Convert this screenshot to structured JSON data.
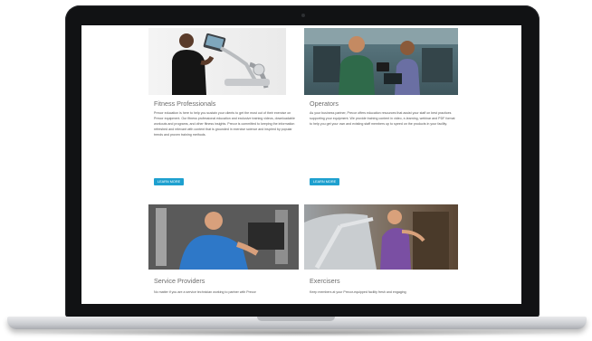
{
  "page": {
    "cards": [
      {
        "title": "Fitness Professionals",
        "body": "Precor education is here to help you sustain your clients to get the most out of their exercise on Precor equipment. Our fitness professional education and exclusive training videos, downloadable workouts and programs, and other fitness insights. Precor is committed to keeping the information refreshed and relevant with content that is grounded in exercise science and inspired by popular trends and proven training methods.",
        "button": "LEARN MORE"
      },
      {
        "title": "Operators",
        "body": "As your business partner, Precor offers education resources that assist your staff on best practices supporting your equipment. We provide training content in video, e-learning, webinar and PDF format to help you get your own and existing staff members up to speed on the products in your facility.",
        "button": "LEARN MORE"
      },
      {
        "title": "Service Providers",
        "body": "No matter if you are a service technician working to partner with Precor",
        "button": ""
      },
      {
        "title": "Exercisers",
        "body": "Keep members at your Precor-equipped facility fresh and engaging",
        "button": ""
      }
    ]
  }
}
